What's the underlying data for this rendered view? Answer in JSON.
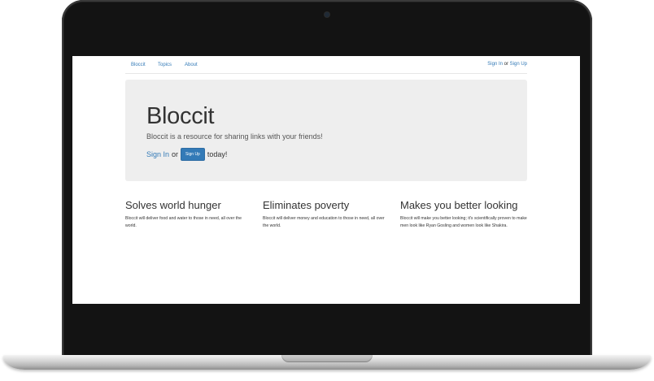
{
  "navbar": {
    "links": [
      "Bloccit",
      "Topics",
      "About"
    ],
    "sign_in": "Sign In",
    "or": "or",
    "sign_up": "Sign Up"
  },
  "jumbotron": {
    "title": "Bloccit",
    "lead": "Bloccit is a resource for sharing links with your friends!",
    "sign_in": "Sign In",
    "or": "or",
    "sign_up_button": "Sign Up",
    "today": "today!"
  },
  "features": [
    {
      "heading": "Solves world hunger",
      "text": "Bloccit will deliver food and water to those in need, all over the world."
    },
    {
      "heading": "Eliminates poverty",
      "text": "Bloccit will deliver money and education to those in need, all over the world."
    },
    {
      "heading": "Makes you better looking",
      "text": "Bloccit will make you better looking; it's scientifically proven to make men look like Ryan Gosling and women look like Shakira."
    }
  ],
  "colors": {
    "link": "#337ab7",
    "jumbotron_bg": "#eeeeee",
    "bezel": "#131313"
  }
}
